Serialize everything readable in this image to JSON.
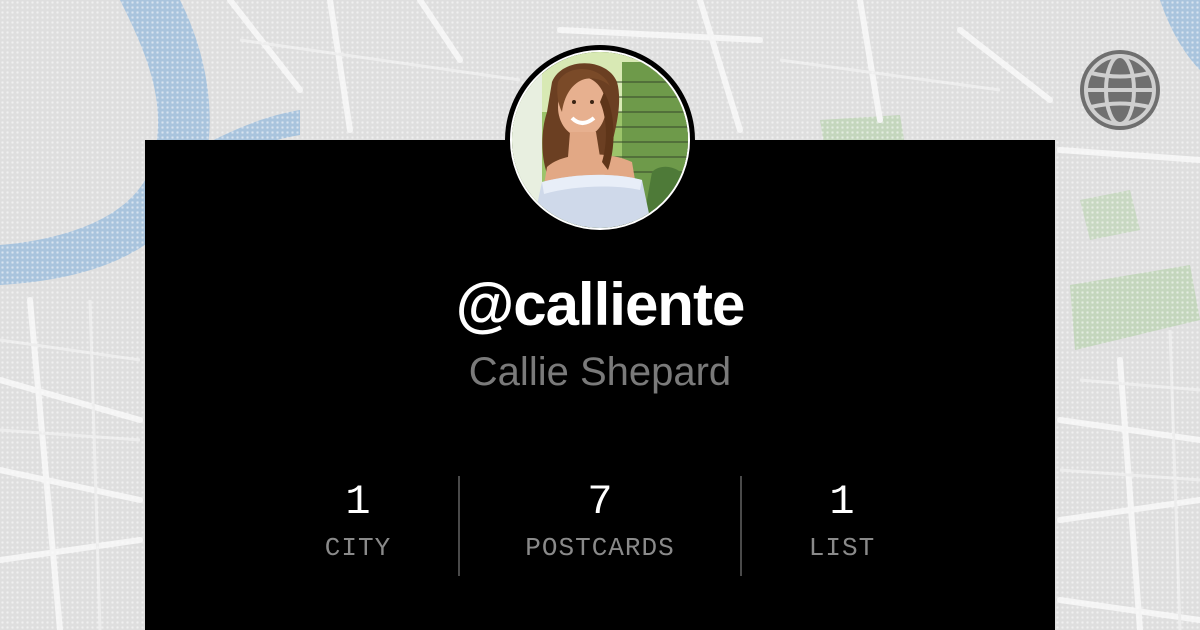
{
  "profile": {
    "username": "@calliente",
    "display_name": "Callie Shepard"
  },
  "stats": [
    {
      "value": "1",
      "label": "CITY"
    },
    {
      "value": "7",
      "label": "POSTCARDS"
    },
    {
      "value": "1",
      "label": "LIST"
    }
  ],
  "icons": {
    "globe": "globe-icon",
    "avatar": "profile-photo"
  },
  "colors": {
    "card_background": "#000000",
    "username": "#ffffff",
    "display_name": "#7a7a7a",
    "stat_label": "#8a8a8a",
    "map_water": "#a9c4dd",
    "map_land": "#dcdcdc",
    "map_park": "#c4d6bd"
  }
}
